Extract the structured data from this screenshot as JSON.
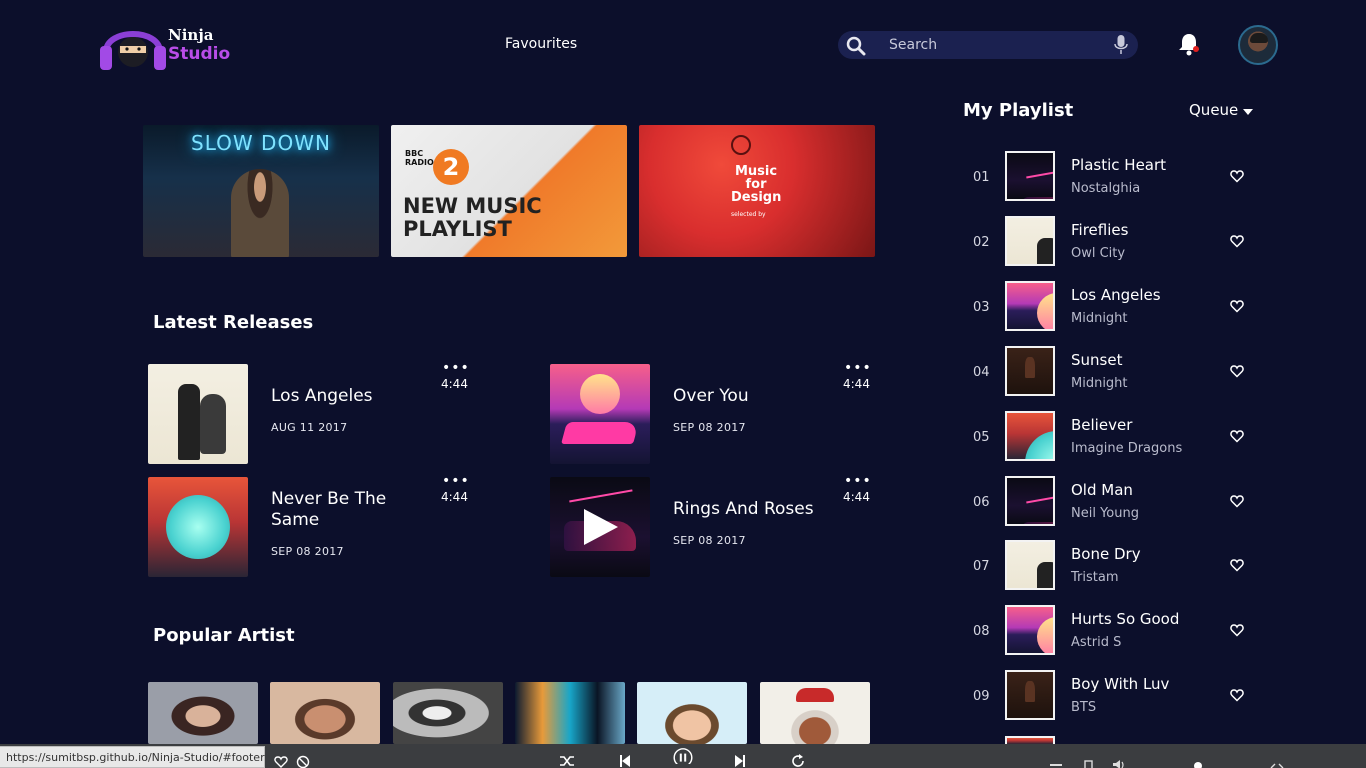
{
  "brand": {
    "line1": "Ninja",
    "line2": "Studio"
  },
  "nav": {
    "favourites": "Favourites"
  },
  "search": {
    "placeholder": "Search"
  },
  "banners": [
    {
      "text": "SLOW DOWN"
    },
    {
      "network": "BBC\nRADIO",
      "channel": "2",
      "text": "NEW MUSIC\nPLAYLIST"
    },
    {
      "text": "Music\nfor\nDesign",
      "sub": "selected by"
    }
  ],
  "latest": {
    "title": "Latest Releases",
    "items": [
      {
        "title": "Los Angeles",
        "date": "AUG 11 2017",
        "duration": "4:44",
        "more": "•••"
      },
      {
        "title": "Over You",
        "date": "SEP 08 2017",
        "duration": "4:44",
        "more": "•••"
      },
      {
        "title": "Never Be The Same",
        "date": "SEP 08 2017",
        "duration": "4:44",
        "more": "•••"
      },
      {
        "title": "Rings And Roses",
        "date": "SEP 08 2017",
        "duration": "4:44",
        "more": "•••"
      }
    ]
  },
  "popular": {
    "title": "Popular Artist"
  },
  "playlist": {
    "title": "My Playlist",
    "queue": "Queue",
    "items": [
      {
        "num": "01",
        "song": "Plastic Heart",
        "artist": "Nostalghia"
      },
      {
        "num": "02",
        "song": "Fireflies",
        "artist": "Owl City"
      },
      {
        "num": "03",
        "song": "Los Angeles",
        "artist": "Midnight"
      },
      {
        "num": "04",
        "song": "Sunset",
        "artist": "Midnight"
      },
      {
        "num": "05",
        "song": "Believer",
        "artist": "Imagine Dragons"
      },
      {
        "num": "06",
        "song": "Old Man",
        "artist": "Neil Young"
      },
      {
        "num": "07",
        "song": "Bone Dry",
        "artist": "Tristam"
      },
      {
        "num": "08",
        "song": "Hurts So Good",
        "artist": "Astrid S"
      },
      {
        "num": "09",
        "song": "Boy With Luv",
        "artist": "BTS"
      }
    ]
  },
  "status": {
    "url": "https://sumitbsp.github.io/Ninja-Studio/#footer"
  },
  "colors": {
    "background": "#0c0f2b",
    "accent": "#b94de8",
    "search_bg": "#1b2150"
  }
}
